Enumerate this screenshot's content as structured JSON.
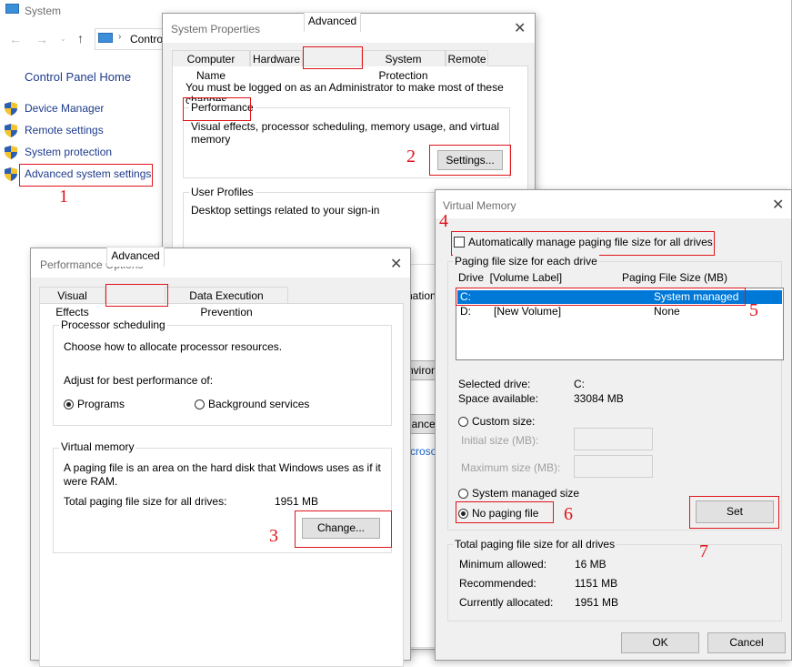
{
  "system_window": {
    "title": "System",
    "breadcrumb": "Contro",
    "nav_back": "←",
    "nav_forward": "→",
    "nav_up": "↑",
    "control_panel_home": "Control Panel Home",
    "links": [
      {
        "label": "Device Manager"
      },
      {
        "label": "Remote settings"
      },
      {
        "label": "System protection"
      },
      {
        "label": "Advanced system settings"
      }
    ],
    "partial_texts": [
      "nation",
      "nviron",
      "Cance",
      "croso"
    ]
  },
  "system_properties": {
    "title": "System Properties",
    "tabs": [
      "Computer Name",
      "Hardware",
      "Advanced",
      "System Protection",
      "Remote"
    ],
    "active_tab": "Advanced",
    "admin_note": "You must be logged on as an Administrator to make most of these changes.",
    "performance": {
      "label": "Performance",
      "description": "Visual effects, processor scheduling, memory usage, and virtual memory",
      "settings_button": "Settings..."
    },
    "user_profiles": {
      "label": "User Profiles",
      "description": "Desktop settings related to your sign-in"
    }
  },
  "performance_options": {
    "title": "Performance Options",
    "tabs": [
      "Visual Effects",
      "Advanced",
      "Data Execution Prevention"
    ],
    "active_tab": "Advanced",
    "processor_scheduling": {
      "label": "Processor scheduling",
      "description": "Choose how to allocate processor resources.",
      "adjust_label": "Adjust for best performance of:",
      "options": [
        "Programs",
        "Background services"
      ],
      "selected": "Programs"
    },
    "virtual_memory": {
      "label": "Virtual memory",
      "description_line1": "A paging file is an area on the hard disk that Windows uses as if it",
      "description_line2": "were RAM.",
      "total_label": "Total paging file size for all drives:",
      "total_value": "1951 MB",
      "change_button": "Change..."
    }
  },
  "virtual_memory": {
    "title": "Virtual Memory",
    "auto_manage_label": "Automatically manage paging file size for all drives",
    "auto_manage_checked": false,
    "each_drive_label": "Paging file size for each drive",
    "col_drive": "Drive  [Volume Label]",
    "col_size": "Paging File Size (MB)",
    "drives": [
      {
        "drive": "C:",
        "label": "",
        "size": "System managed",
        "selected": true
      },
      {
        "drive": "D:",
        "label": "[New Volume]",
        "size": "None",
        "selected": false
      }
    ],
    "selected_drive_label": "Selected drive:",
    "selected_drive_value": "C:",
    "space_available_label": "Space available:",
    "space_available_value": "33084 MB",
    "custom_size_label": "Custom size:",
    "initial_size_label": "Initial size (MB):",
    "initial_size_value": "",
    "maximum_size_label": "Maximum size (MB):",
    "maximum_size_value": "",
    "system_managed_label": "System managed size",
    "no_paging_label": "No paging file",
    "selected_option": "No paging file",
    "set_button": "Set",
    "total_group_label": "Total paging file size for all drives",
    "minimum_label": "Minimum allowed:",
    "minimum_value": "16 MB",
    "recommended_label": "Recommended:",
    "recommended_value": "1151 MB",
    "allocated_label": "Currently allocated:",
    "allocated_value": "1951 MB",
    "ok_button": "OK",
    "cancel_button": "Cancel",
    "selection_color": "#0078d7"
  },
  "annotations": {
    "steps": [
      "1",
      "2",
      "3",
      "4",
      "5",
      "6",
      "7"
    ],
    "color": "#e0141a"
  }
}
